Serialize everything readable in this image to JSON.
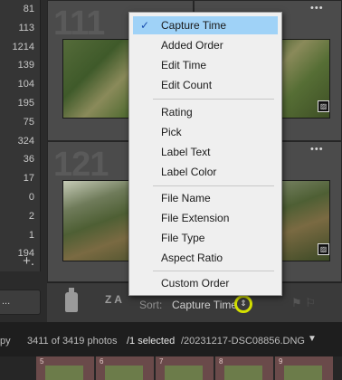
{
  "left_panel": {
    "counts": [
      "81",
      "113",
      "1214",
      "139",
      "104",
      "195",
      "75",
      "324",
      "36",
      "17",
      "0",
      "2",
      "1",
      "194"
    ],
    "plus_label": "+.",
    "bottom_button_label": "..."
  },
  "grid": {
    "cells": [
      {
        "number": "111"
      },
      {
        "number": "121"
      }
    ],
    "dots_label": "•••"
  },
  "toolbar": {
    "sort_label": "Sort:",
    "sort_value": "Capture Time",
    "az_label": "Z A"
  },
  "status_bar": {
    "left_text": "py",
    "count_text": "3411 of 3419 photos",
    "selected_text": "/1 selected",
    "path_text": "/20231217-DSC08856.DNG",
    "caret": "▼"
  },
  "filmstrip": {
    "numbers": [
      "5",
      "6",
      "7",
      "8",
      "9"
    ]
  },
  "sort_menu": {
    "groups": [
      [
        {
          "label": "Capture Time",
          "checked": true
        },
        {
          "label": "Added Order"
        },
        {
          "label": "Edit Time"
        },
        {
          "label": "Edit Count"
        }
      ],
      [
        {
          "label": "Rating"
        },
        {
          "label": "Pick"
        },
        {
          "label": "Label Text"
        },
        {
          "label": "Label Color"
        }
      ],
      [
        {
          "label": "File Name"
        },
        {
          "label": "File Extension"
        },
        {
          "label": "File Type"
        },
        {
          "label": "Aspect Ratio"
        }
      ],
      [
        {
          "label": "Custom Order"
        }
      ]
    ],
    "check_glyph": "✓"
  },
  "colors": {
    "highlight": "#9fd2f7",
    "annotation_ring": "#d4e000"
  }
}
